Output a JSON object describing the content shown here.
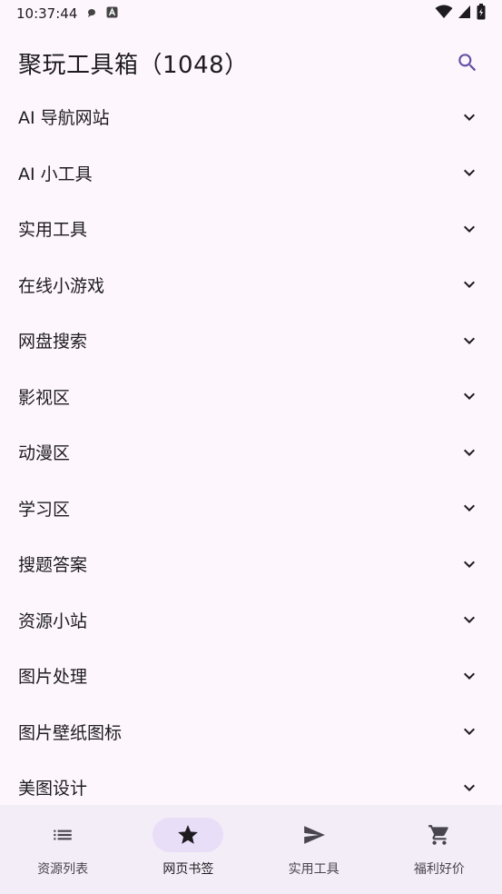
{
  "status_bar": {
    "time": "10:37:44"
  },
  "app_bar": {
    "title": "聚玩工具箱（1048）"
  },
  "categories": [
    "AI 导航网站",
    "AI 小工具",
    "实用工具",
    "在线小游戏",
    "网盘搜索",
    "影视区",
    "动漫区",
    "学习区",
    "搜题答案",
    "资源小站",
    "图片处理",
    "图片壁纸图标",
    "美图设计"
  ],
  "nav": [
    {
      "label": "资源列表",
      "icon": "list-icon",
      "active": false
    },
    {
      "label": "网页书签",
      "icon": "star-icon",
      "active": true
    },
    {
      "label": "实用工具",
      "icon": "send-icon",
      "active": false
    },
    {
      "label": "福利好价",
      "icon": "cart-icon",
      "active": false
    }
  ],
  "colors": {
    "background": "#fdf7fd",
    "primary": "#6750a4",
    "nav_background": "#f3edf7",
    "nav_indicator": "#e8def8"
  }
}
